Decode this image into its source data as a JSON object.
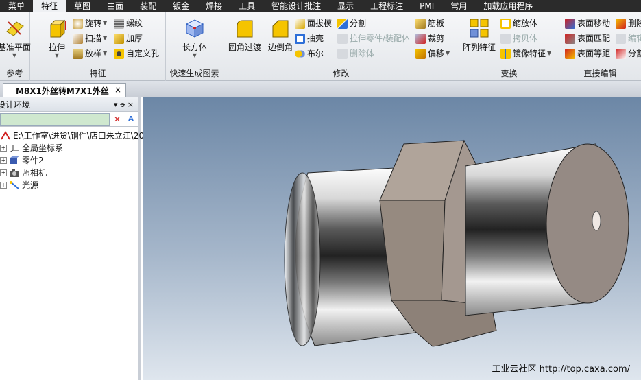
{
  "menu": {
    "items": [
      "菜单",
      "特征",
      "草图",
      "曲面",
      "装配",
      "钣金",
      "焊接",
      "工具",
      "智能设计批注",
      "显示",
      "工程标注",
      "PMI",
      "常用",
      "加载应用程序"
    ],
    "active_index": 1
  },
  "ribbon": {
    "reference": {
      "label": "参考",
      "datum_plane": "基准平面"
    },
    "feature": {
      "label": "特征",
      "extrude": "拉伸",
      "revolve": "旋转",
      "sweep": "扫描",
      "loft": "放样",
      "thread": "螺纹",
      "thicken": "加厚",
      "custom_hole": "自定义孔"
    },
    "quick": {
      "label": "快速生成图素",
      "box": "长方体"
    },
    "modify": {
      "label": "修改",
      "fillet": "圆角过渡",
      "chamfer": "边倒角",
      "draft": "面拔模",
      "shell": "抽壳",
      "boolean": "布尔",
      "split": "分割",
      "extrude_part": "拉伸零件/装配体",
      "remove_body": "删除体",
      "rib": "筋板",
      "trim": "裁剪",
      "offset": "偏移"
    },
    "transform": {
      "label": "变换",
      "pattern": "阵列特征",
      "scale": "缩放体",
      "copy_body": "拷贝体",
      "mirror": "镜像特征"
    },
    "direct_edit": {
      "label": "直接编辑",
      "face_move": "表面移动",
      "face_match": "表面匹配",
      "face_equidistant": "表面等距",
      "delete": "删除",
      "edit": "编辑",
      "split": "分割"
    }
  },
  "document": {
    "tab_title": "M8X1外丝转M7X1外丝",
    "close": "×"
  },
  "panel": {
    "title": "设计环境",
    "pin": "▾  ᵽ  ×",
    "tree": [
      "E:\\工作室\\进货\\铜件\\店口朱立江\\20",
      "全局坐标系",
      "零件2",
      "照相机",
      "光源"
    ]
  },
  "watermark": "工业云社区 http://top.caxa.com/",
  "colors": {
    "accent": "#e8a020",
    "menubar": "#2b2b2b"
  }
}
